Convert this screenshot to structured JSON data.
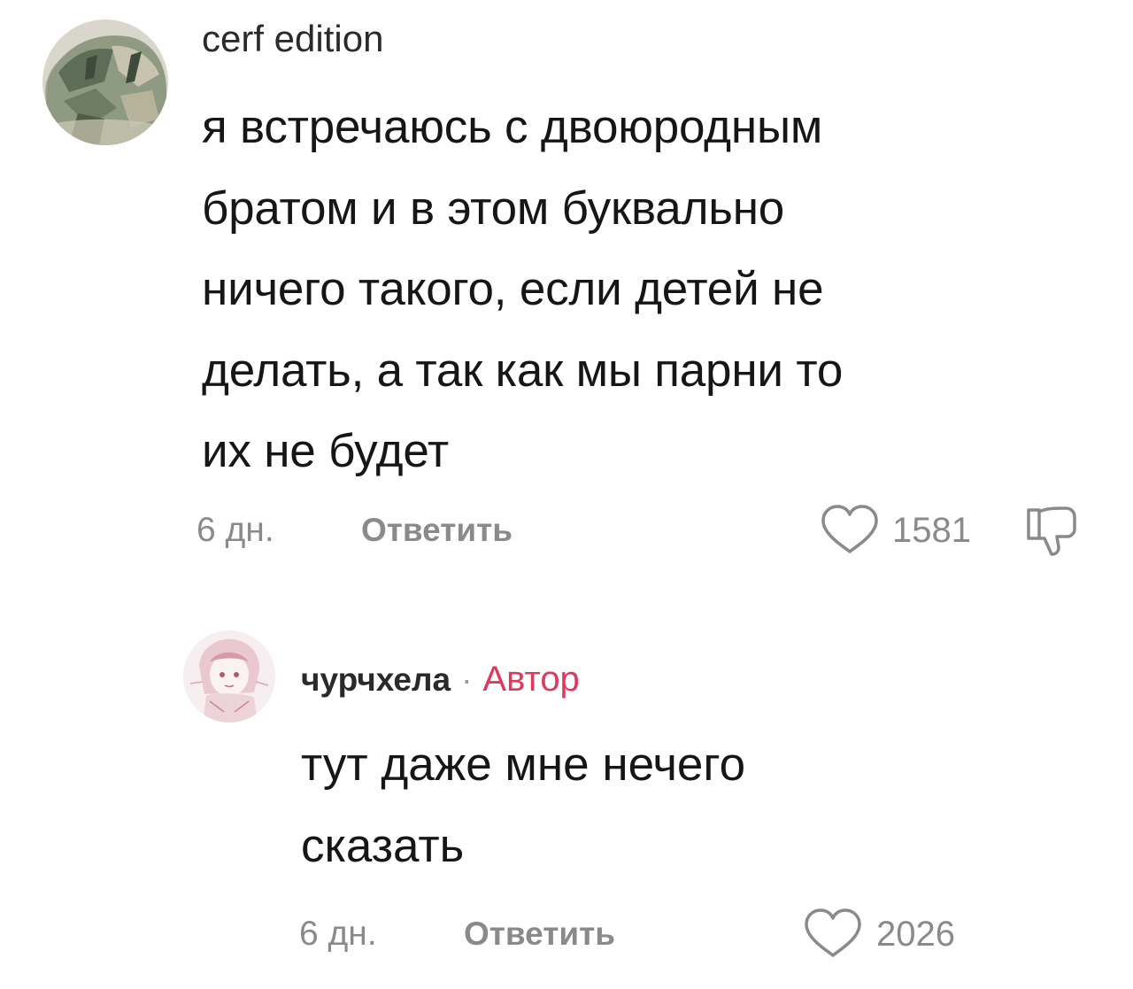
{
  "comments": [
    {
      "username": "cerf edition",
      "avatar_icon": "camouflage-helmet-avatar",
      "text_lines": [
        "я встречаюсь с двоюродным",
        "братом и в этом буквально",
        "ничего такого, если детей не",
        "делать, а так как мы парни то",
        "их не будет"
      ],
      "time": "6 дн.",
      "reply_label": "Ответить",
      "likes": "1581",
      "like_icon": "heart-outline-icon",
      "dislike_icon": "thumbs-down-outline-icon"
    }
  ],
  "reply": {
    "username": "чурчхела",
    "separator": "·",
    "badge": "Автор",
    "avatar_icon": "anime-girl-avatar",
    "text_lines": [
      "тут даже мне нечего",
      "сказать"
    ],
    "time": "6 дн.",
    "reply_label": "Ответить",
    "likes": "2026",
    "like_icon": "heart-outline-icon"
  },
  "colors": {
    "text": "#161616",
    "meta": "#8a8a8a",
    "author_badge": "#e2385c",
    "background": "#ffffff"
  }
}
